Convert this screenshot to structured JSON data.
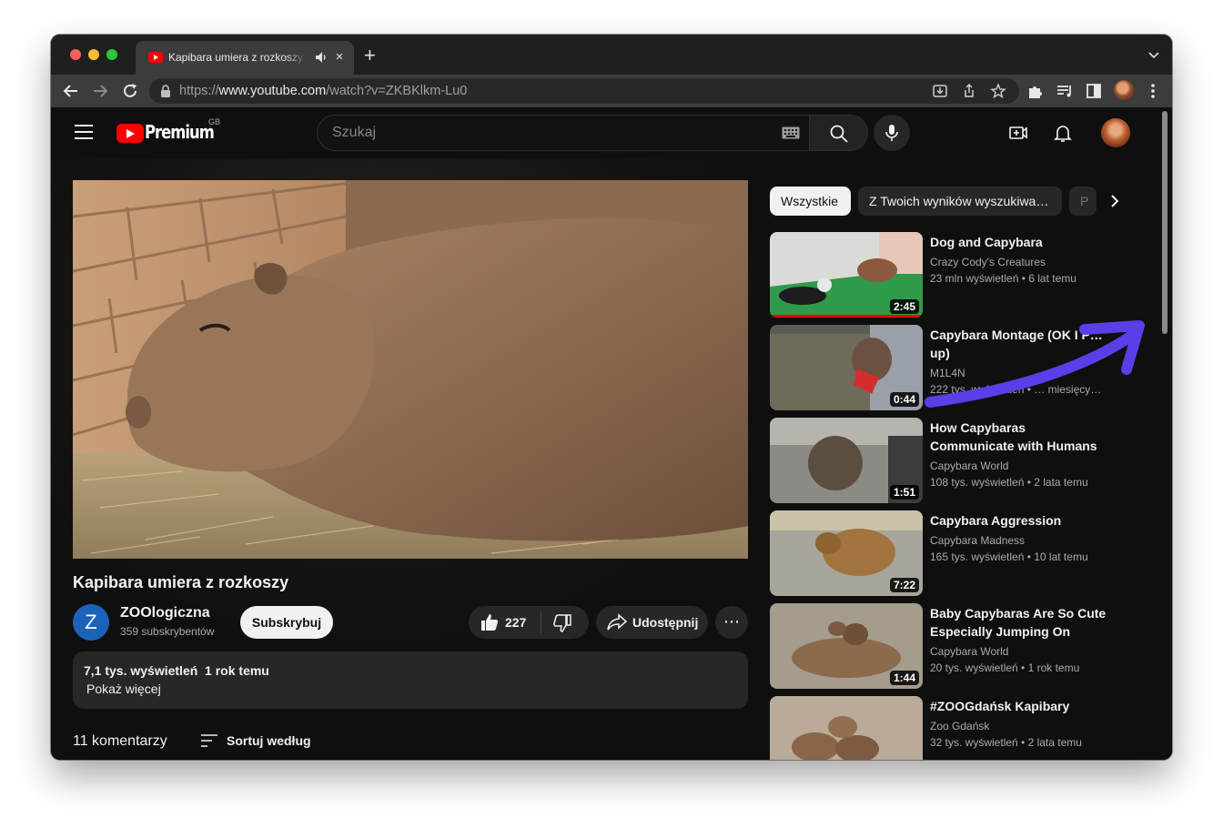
{
  "browser": {
    "tab_title": "Kapibara umiera z rozkoszy",
    "new_tab_label": "+",
    "close_label": "×",
    "url_scheme": "https://",
    "url_domain": "www.youtube.com",
    "url_path": "/watch?v=ZKBKlkm-Lu0"
  },
  "header": {
    "brand": "Premium",
    "country": "GB",
    "search_placeholder": "Szukaj"
  },
  "video": {
    "title": "Kapibara umiera z rozkoszy",
    "channel": "ZOOlogiczna",
    "channel_initial": "Z",
    "subscribers": "359 subskrybentów",
    "subscribe_label": "Subskrybuj",
    "likes": "227",
    "share_label": "Udostępnij",
    "more_label": "⋯",
    "views_date": "7,1 tys. wyświetleń  1 rok temu",
    "show_more": "Pokaż więcej",
    "comments": "11 komentarzy",
    "sort_label": "Sortuj według"
  },
  "chips": [
    "Wszystkie",
    "Z Twoich wyników wyszukiwa…",
    "P"
  ],
  "recommendations": [
    {
      "title": "Dog and Capybara",
      "channel": "Crazy Cody's Creatures",
      "meta": "23 mln wyświetleń  • 6 lat temu",
      "duration": "2:45",
      "watched": true
    },
    {
      "title": "Capybara Montage (OK I P… up)",
      "channel": "M1L4N",
      "meta": "222 tys. wyświetleń • … miesięcy…",
      "duration": "0:44",
      "watched": false
    },
    {
      "title": "How Capybaras Communicate with Humans",
      "channel": "Capybara World",
      "meta": "108 tys. wyświetleń  • 2 lata temu",
      "duration": "1:51",
      "watched": false
    },
    {
      "title": "Capybara Aggression",
      "channel": "Capybara Madness",
      "meta": "165 tys. wyświetleń  • 10 lat temu",
      "duration": "7:22",
      "watched": false
    },
    {
      "title": "Baby Capybaras Are So Cute Especially Jumping On Older…",
      "channel": "Capybara World",
      "meta": "20 tys. wyświetleń  • 1 rok temu",
      "duration": "1:44",
      "watched": false
    },
    {
      "title": "#ZOOGdańsk Kapibary",
      "channel": "Zoo Gdańsk",
      "meta": "32 tys. wyświetleń  • 2 lata temu",
      "duration": "",
      "watched": false
    }
  ],
  "colors": {
    "accent": "#ff0000",
    "annotation_arrow": "#5b3ee8",
    "page_bg": "#0f0f0f"
  }
}
